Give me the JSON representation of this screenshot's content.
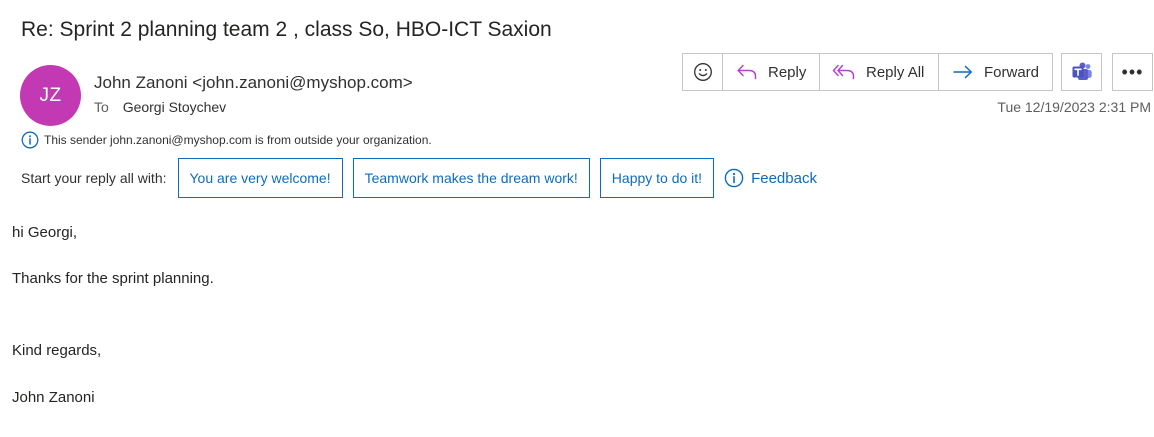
{
  "email": {
    "subject": "Re: Sprint 2 planning team 2 , class So, HBO-ICT Saxion",
    "sender": {
      "initials": "JZ",
      "display": "John Zanoni <john.zanoni@myshop.com>",
      "avatar_color": "#c239b3"
    },
    "to_label": "To",
    "to_name": "Georgi Stoychev",
    "timestamp": "Tue 12/19/2023 2:31 PM",
    "external_warning": "This sender john.zanoni@myshop.com is from outside your organization.",
    "body": {
      "greeting": "hi Georgi,",
      "line1": "Thanks for the sprint planning.",
      "closing": "Kind regards,",
      "signature": "John Zanoni"
    }
  },
  "actions": {
    "emoji_icon": "smiley-icon",
    "reply": "Reply",
    "reply_all": "Reply All",
    "forward": "Forward",
    "teams_icon": "teams-icon",
    "more": "•••"
  },
  "suggested_replies": {
    "label": "Start your reply all with:",
    "chips": [
      "You are very welcome!",
      "Teamwork makes the dream work!",
      "Happy to do it!"
    ],
    "feedback": "Feedback"
  },
  "colors": {
    "accent": "#0f6cbd",
    "reply_icon": "#b146c2",
    "teams": "#5b5fc7"
  }
}
